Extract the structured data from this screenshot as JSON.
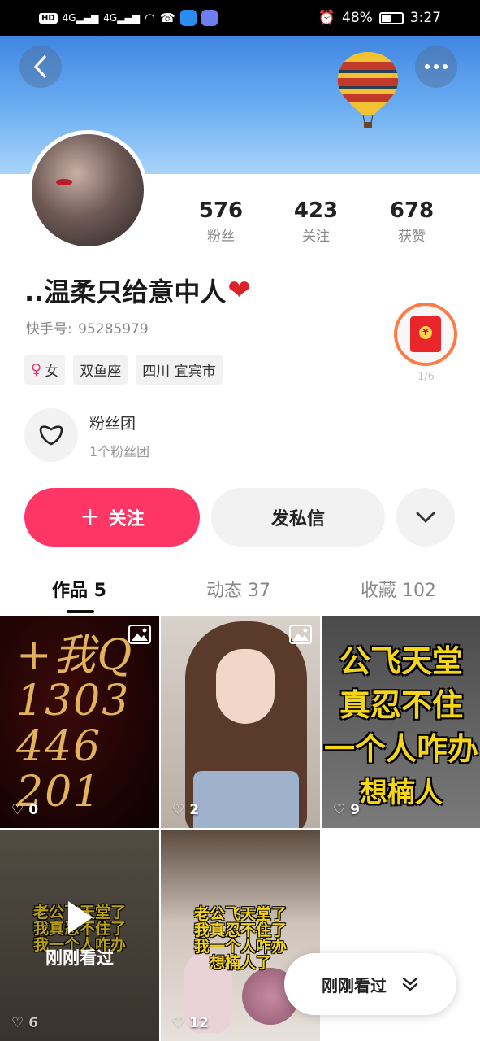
{
  "status_bar": {
    "left_chip": "HD",
    "net1": "4G",
    "net2": "4G",
    "battery_pct": "48%",
    "time": "3:27"
  },
  "profile": {
    "stats": [
      {
        "num": "576",
        "label": "粉丝"
      },
      {
        "num": "423",
        "label": "关注"
      },
      {
        "num": "678",
        "label": "获赞"
      }
    ],
    "nickname": "..温柔只给意中人",
    "nickname_emoji": "❤",
    "account_label": "快手号:",
    "account_id": "95285979",
    "tags": {
      "gender_symbol": "♀",
      "gender": "女",
      "zodiac": "双鱼座",
      "location": "四川 宜宾市"
    },
    "redpack_count": "1/6",
    "fanclub_title": "粉丝团",
    "fanclub_sub": "1个粉丝团"
  },
  "actions": {
    "follow_plus": "+",
    "follow_label": "关注",
    "message_label": "发私信"
  },
  "tabs": [
    {
      "label": "作品 5"
    },
    {
      "label": "动态 37"
    },
    {
      "label": "收藏 102"
    }
  ],
  "grid": {
    "tile1": {
      "likes": "0",
      "hand_lines": [
        "+我Q",
        "1303",
        "446",
        "201"
      ]
    },
    "tile2": {
      "likes": "2"
    },
    "tile3": {
      "likes": "9",
      "lines": [
        "公飞天堂",
        "真忍不住",
        "一个人咋办",
        "想楠人"
      ]
    },
    "tile4": {
      "likes": "6",
      "lines": [
        "老公飞天堂了",
        "我真忍不住了",
        "我一个人咋办"
      ],
      "watched": "刚刚看过"
    },
    "tile5": {
      "likes": "12",
      "lines": [
        "老公飞天堂了",
        "我真忍不住了",
        "我一个人咋办",
        "想楠人了"
      ]
    }
  },
  "recent_pill": {
    "label": "刚刚看过"
  },
  "colors": {
    "accent": "#fe3666",
    "banner": "#4a90e2",
    "caption_yellow": "#f5d518"
  }
}
